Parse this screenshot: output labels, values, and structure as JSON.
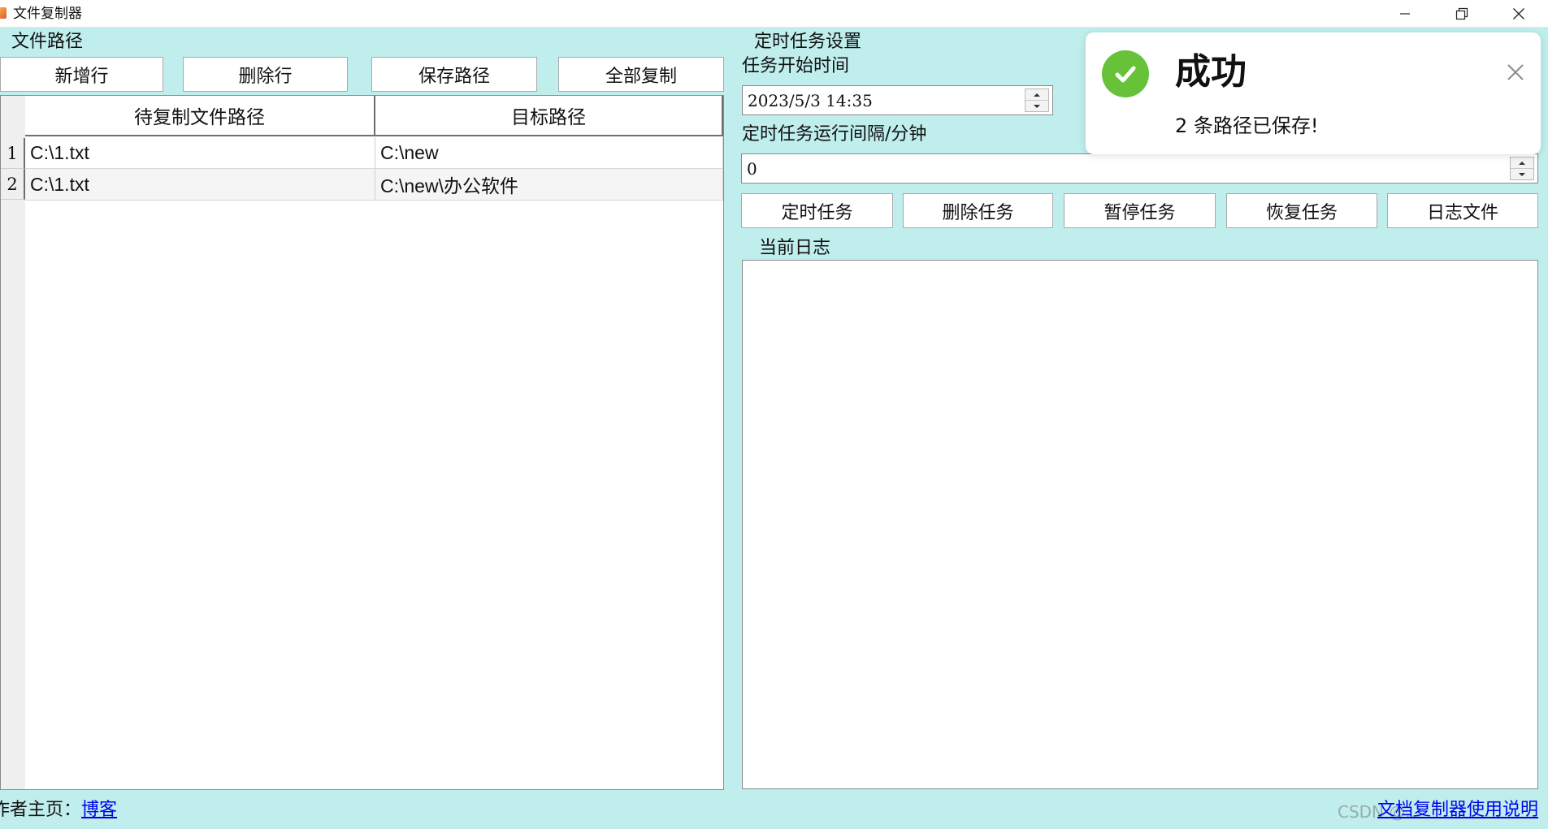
{
  "window": {
    "title": "文件复制器"
  },
  "left_panel": {
    "group_title": "文件路径",
    "buttons": {
      "add_row": "新增行",
      "delete_row": "删除行",
      "save_paths": "保存路径",
      "copy_all": "全部复制"
    },
    "table": {
      "columns": [
        "待复制文件路径",
        "目标路径"
      ],
      "rows": [
        {
          "num": "1",
          "source": "C:\\1.txt",
          "target": "C:\\new"
        },
        {
          "num": "2",
          "source": "C:\\1.txt",
          "target": "C:\\new\\办公软件"
        }
      ]
    }
  },
  "right_panel": {
    "group_title": "定时任务设置",
    "start_time_label": "任务开始时间",
    "start_time_value": "2023/5/3 14:35",
    "interval_label": "定时任务运行间隔/分钟",
    "interval_value": "0",
    "buttons": {
      "schedule": "定时任务",
      "delete_task": "删除任务",
      "pause_task": "暂停任务",
      "resume_task": "恢复任务",
      "log_file": "日志文件"
    },
    "log_title": "当前日志",
    "log_content": ""
  },
  "toast": {
    "title": "成功",
    "message": "2 条路径已保存!",
    "status_color": "#67c23a"
  },
  "footer": {
    "author_label": "作者主页：",
    "author_link": "博客",
    "help_link": "文档复制器使用说明",
    "watermark": "CSDN @..."
  },
  "colors": {
    "background": "#bfeeed",
    "link": "#0000ee"
  }
}
